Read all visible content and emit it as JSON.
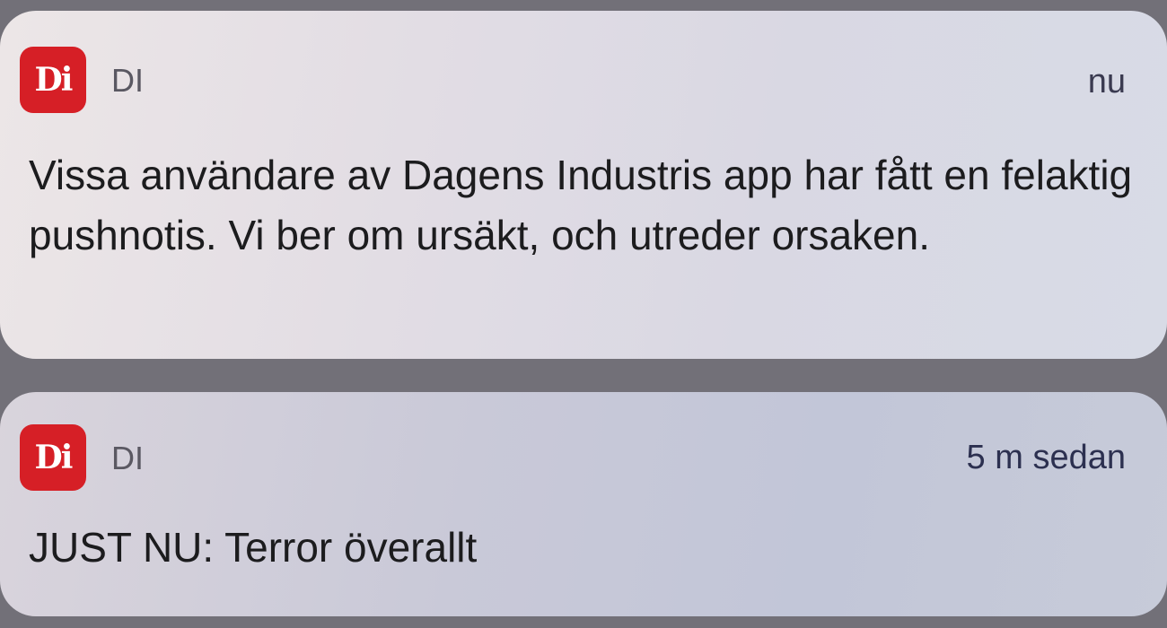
{
  "notifications": [
    {
      "app_icon_text": "Di",
      "app_name": "DI",
      "time": "nu",
      "message": "Vissa användare av Dagens Industris app har fått en felaktig pushnotis. Vi ber om ursäkt, och utreder orsaken."
    },
    {
      "app_icon_text": "Di",
      "app_name": "DI",
      "time": "5 m sedan",
      "message": "JUST NU: Terror överallt"
    }
  ],
  "colors": {
    "icon_background": "#d61f26",
    "icon_text": "#ffffff",
    "message_text": "#1c1c1e",
    "app_name_text": "#5a5862"
  }
}
